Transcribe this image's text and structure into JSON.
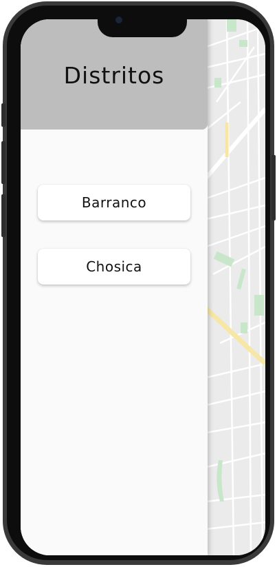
{
  "drawer": {
    "title": "Distritos",
    "items": [
      {
        "label": "Barranco"
      },
      {
        "label": "Chosica"
      }
    ]
  },
  "colors": {
    "header_bg": "#bdbdbd",
    "drawer_bg": "#fafafa",
    "map_bg": "#ebebeb",
    "map_park": "#c8e6c9",
    "map_highway": "#f7e7a6"
  }
}
